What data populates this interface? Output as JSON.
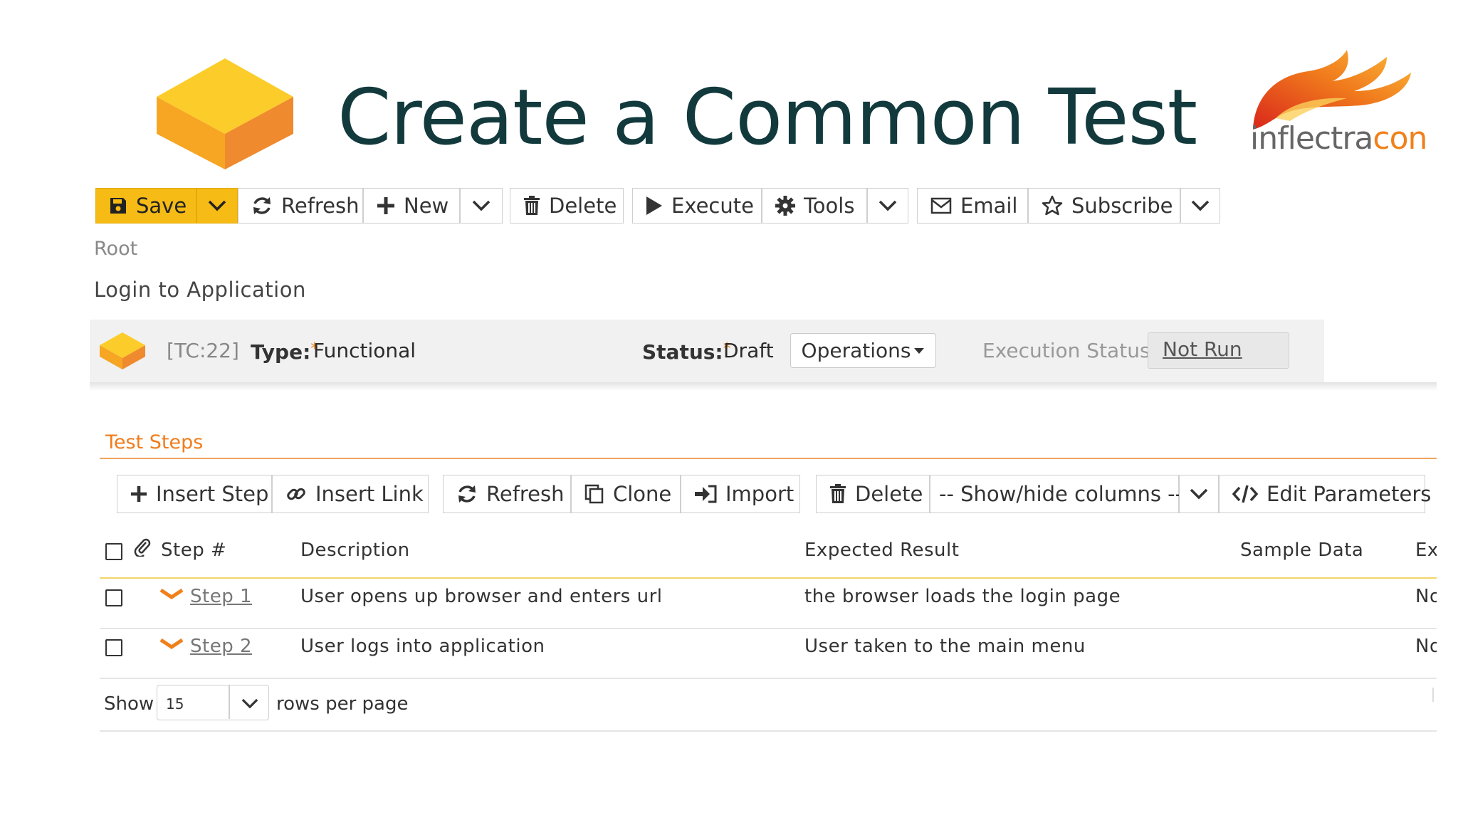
{
  "header": {
    "title": "Create a Common Test",
    "logo": {
      "text_main": "inflectra",
      "text_accent": "con"
    }
  },
  "toolbar": {
    "save": "Save",
    "refresh": "Refresh",
    "new": "New",
    "delete": "Delete",
    "execute": "Execute",
    "tools": "Tools",
    "email": "Email",
    "subscribe": "Subscribe"
  },
  "breadcrumb": {
    "root": "Root",
    "name": "Login to Application"
  },
  "testcase": {
    "id": "[TC:22]",
    "type_label": "Type:",
    "type_value": "Functional",
    "status_label": "Status:",
    "status_value": "Draft",
    "operations": "Operations",
    "execution_status_label": "Execution Status:",
    "execution_status_value": "Not Run",
    "required_marker": "*"
  },
  "steps_section": {
    "heading": "Test Steps",
    "toolbar": {
      "insert_step": "Insert Step",
      "insert_link": "Insert Link",
      "refresh": "Refresh",
      "clone": "Clone",
      "import": "Import",
      "delete": "Delete",
      "show_hide": "-- Show/hide columns --",
      "edit_parameters": "Edit Parameters"
    },
    "columns": [
      "Step #",
      "Description",
      "Expected Result",
      "Sample Data",
      "Ex"
    ],
    "rows": [
      {
        "step": "Step 1",
        "description": "User opens up browser and enters url",
        "expected": "the browser loads the login page",
        "ex": "No"
      },
      {
        "step": "Step 2",
        "description": "User logs into application",
        "expected": "User taken to the main menu",
        "ex": "No"
      }
    ],
    "pagination": {
      "show": "Show",
      "rows_per_page_value": "15",
      "rows_per_page_label": "rows per page"
    }
  },
  "colors": {
    "title": "#123a3d",
    "save_button": "#f6bb15",
    "accent_orange": "#ef7d1e",
    "table_header_line": "#f3d36a"
  }
}
